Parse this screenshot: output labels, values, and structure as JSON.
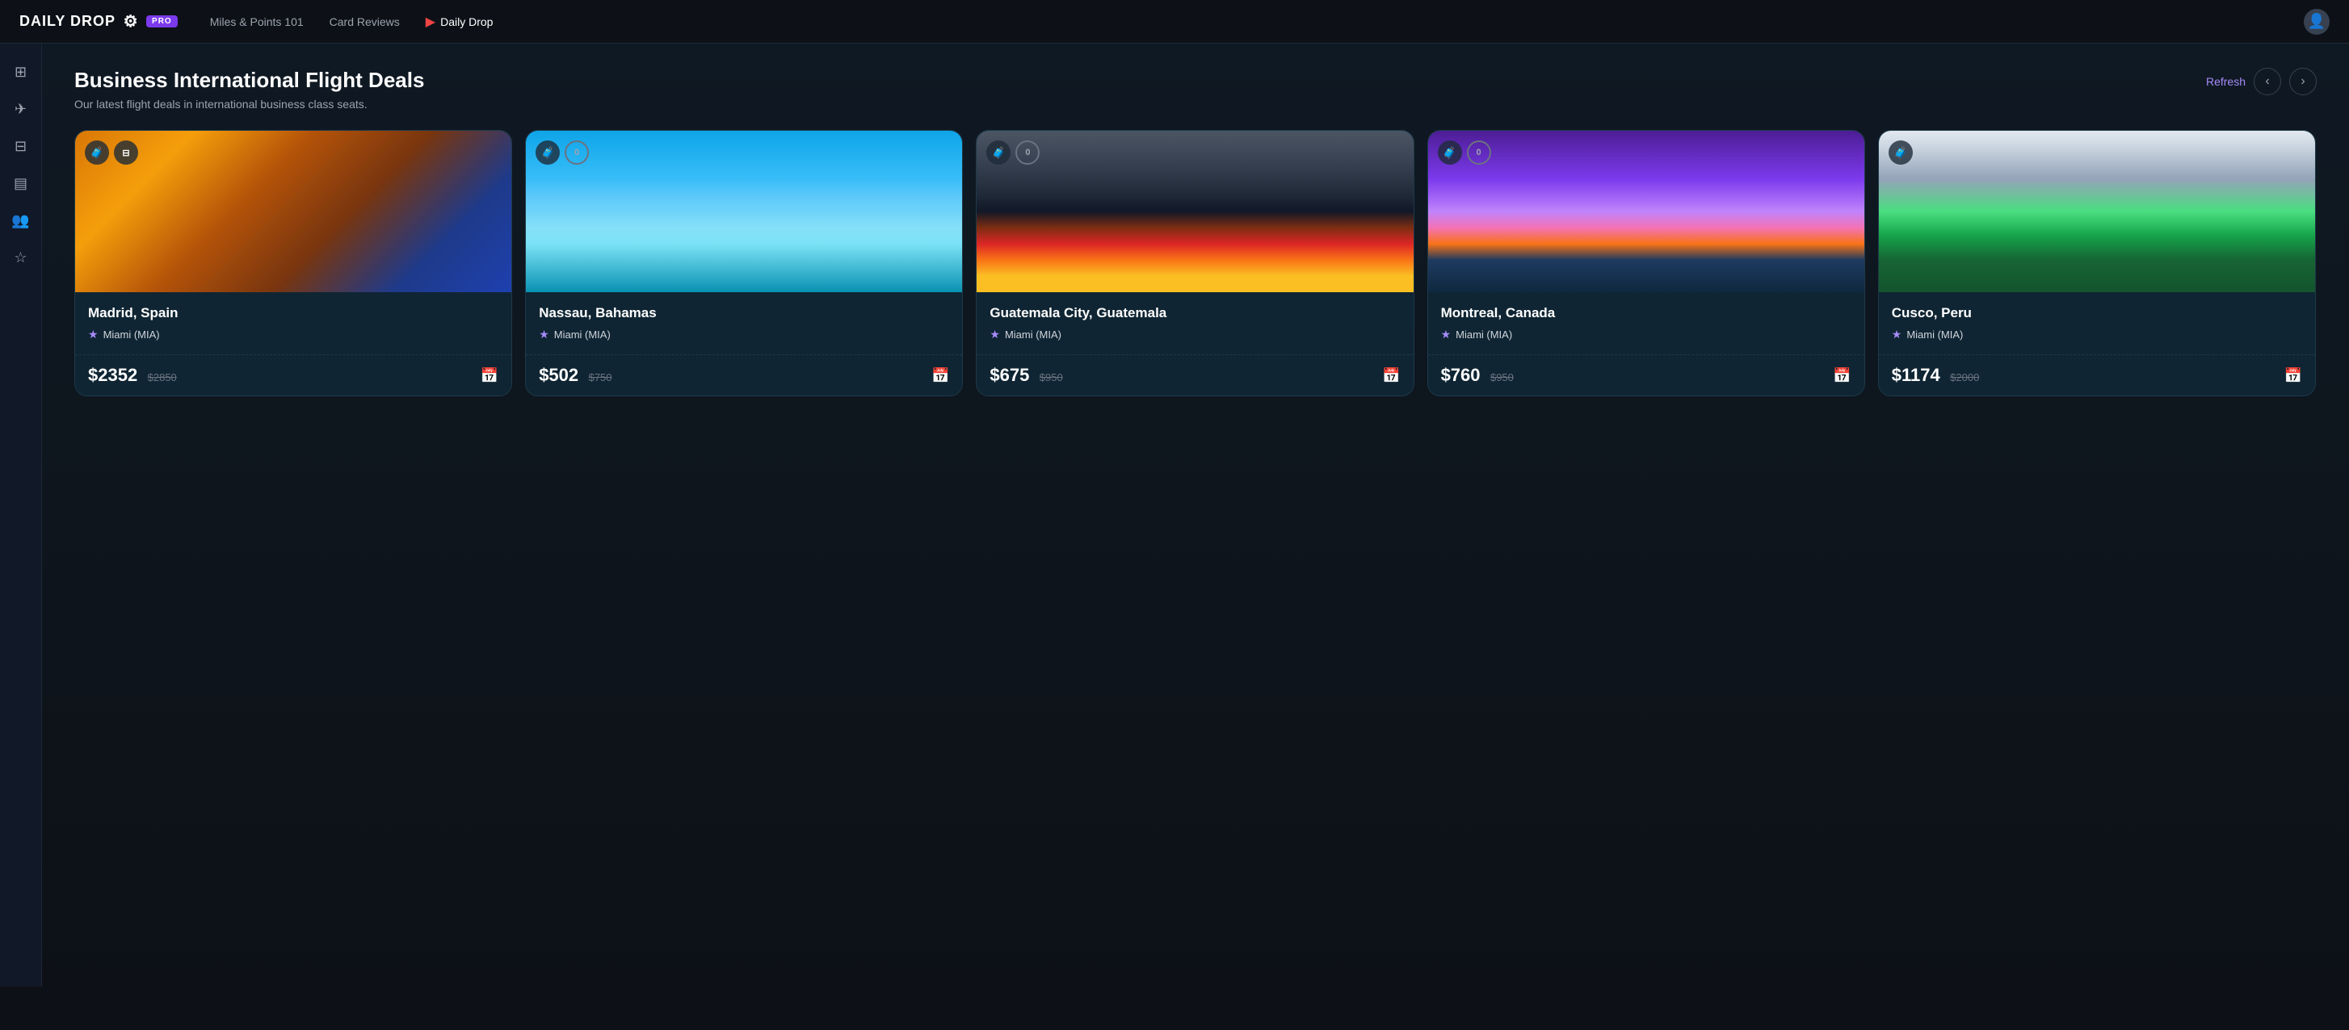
{
  "nav": {
    "logo_text": "DAILY DROP",
    "pro_badge": "PRO",
    "links": [
      {
        "id": "miles",
        "label": "Miles & Points 101",
        "active": false
      },
      {
        "id": "card-reviews",
        "label": "Card Reviews",
        "active": false
      },
      {
        "id": "daily-drop",
        "label": "Daily Drop",
        "active": true
      }
    ],
    "avatar_icon": "👤"
  },
  "sidebar": {
    "items": [
      {
        "id": "dashboard",
        "icon": "⊞",
        "active": false
      },
      {
        "id": "flights",
        "icon": "✈",
        "active": false
      },
      {
        "id": "hotels",
        "icon": "⊟",
        "active": false
      },
      {
        "id": "cards",
        "icon": "▤",
        "active": false
      },
      {
        "id": "community",
        "icon": "👥",
        "active": false
      },
      {
        "id": "favorites",
        "icon": "☆",
        "active": false
      }
    ]
  },
  "section": {
    "title": "Business International Flight Deals",
    "subtitle": "Our latest flight deals in international business class seats.",
    "refresh_label": "Refresh"
  },
  "deals": [
    {
      "id": "madrid",
      "destination": "Madrid, Spain",
      "origin": "Miami (MIA)",
      "price_current": "$2352",
      "price_original": "$2850",
      "image_class": "card-img-madrid",
      "badge1_icon": "🧳",
      "badge2_icon": "⊟"
    },
    {
      "id": "nassau",
      "destination": "Nassau, Bahamas",
      "origin": "Miami (MIA)",
      "price_current": "$502",
      "price_original": "$750",
      "image_class": "card-img-nassau",
      "badge1_icon": "🧳",
      "badge2_icon": "0"
    },
    {
      "id": "guatemala",
      "destination": "Guatemala City, Guatemala",
      "origin": "Miami (MIA)",
      "price_current": "$675",
      "price_original": "$950",
      "image_class": "card-img-guatemala",
      "badge1_icon": "🧳",
      "badge2_icon": "0"
    },
    {
      "id": "montreal",
      "destination": "Montreal, Canada",
      "origin": "Miami (MIA)",
      "price_current": "$760",
      "price_original": "$950",
      "image_class": "card-img-montreal",
      "badge1_icon": "🧳",
      "badge2_icon": "0"
    },
    {
      "id": "cusco",
      "destination": "Cusco, Peru",
      "origin": "Miami (MIA)",
      "price_current": "$1174",
      "price_original": "$2000",
      "image_class": "card-img-cusco",
      "badge1_icon": "🧳",
      "badge2_icon": ""
    }
  ]
}
